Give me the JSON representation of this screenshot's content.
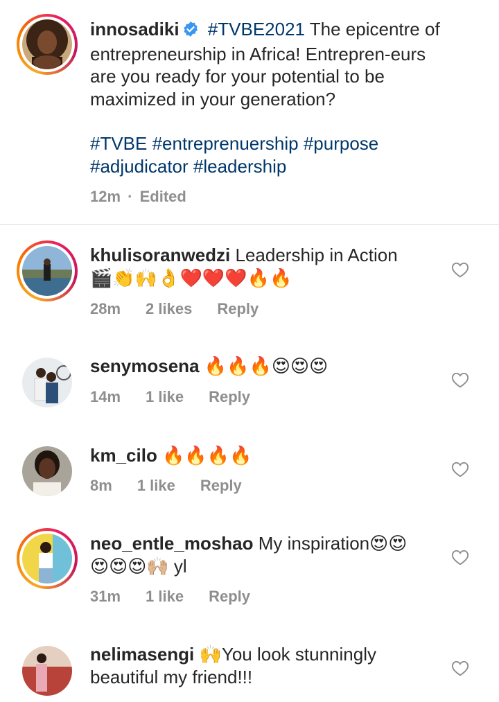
{
  "post": {
    "username": "innosadiki",
    "caption_hashtag": "#TVBE2021",
    "caption_text": " The epicentre of entrepreneurship in Africa! Entrepren-eurs are you ready for your potential to be maximized in your generation?",
    "hashtags_line1": "#TVBE #entreprenuership #purpose",
    "hashtags_line2": "#adjudicator #leadership",
    "time": "12m",
    "separator": "·",
    "edited": "Edited"
  },
  "comments": [
    {
      "username": "khulisoranwedzi",
      "text": " Leadership in Action",
      "emoji_line": "🎬👏🙌👌❤️❤️❤️🔥🔥",
      "time": "28m",
      "likes": "2 likes",
      "reply": "Reply"
    },
    {
      "username": "senymosena",
      "emoji_line": " 🔥🔥🔥😍😍😍",
      "time": "14m",
      "likes": "1 like",
      "reply": "Reply"
    },
    {
      "username": "km_cilo",
      "emoji_line": " 🔥🔥🔥🔥",
      "time": "8m",
      "likes": "1 like",
      "reply": "Reply"
    },
    {
      "username": "neo_entle_moshao",
      "text": " My inspiration😍😍",
      "emoji_line": "😍😍😍🙌🏼 yl",
      "time": "31m",
      "likes": "1 like",
      "reply": "Reply"
    },
    {
      "username": "nelimasengi",
      "text": " 🙌You look stunningly beautiful my friend!!!"
    }
  ],
  "colors": {
    "hashtag": "#00376b",
    "meta": "#8e8e8e",
    "verified": "#3897f0",
    "divider": "#dbdbdb"
  },
  "icons": [
    "verified-badge-icon",
    "heart-outline-icon"
  ]
}
